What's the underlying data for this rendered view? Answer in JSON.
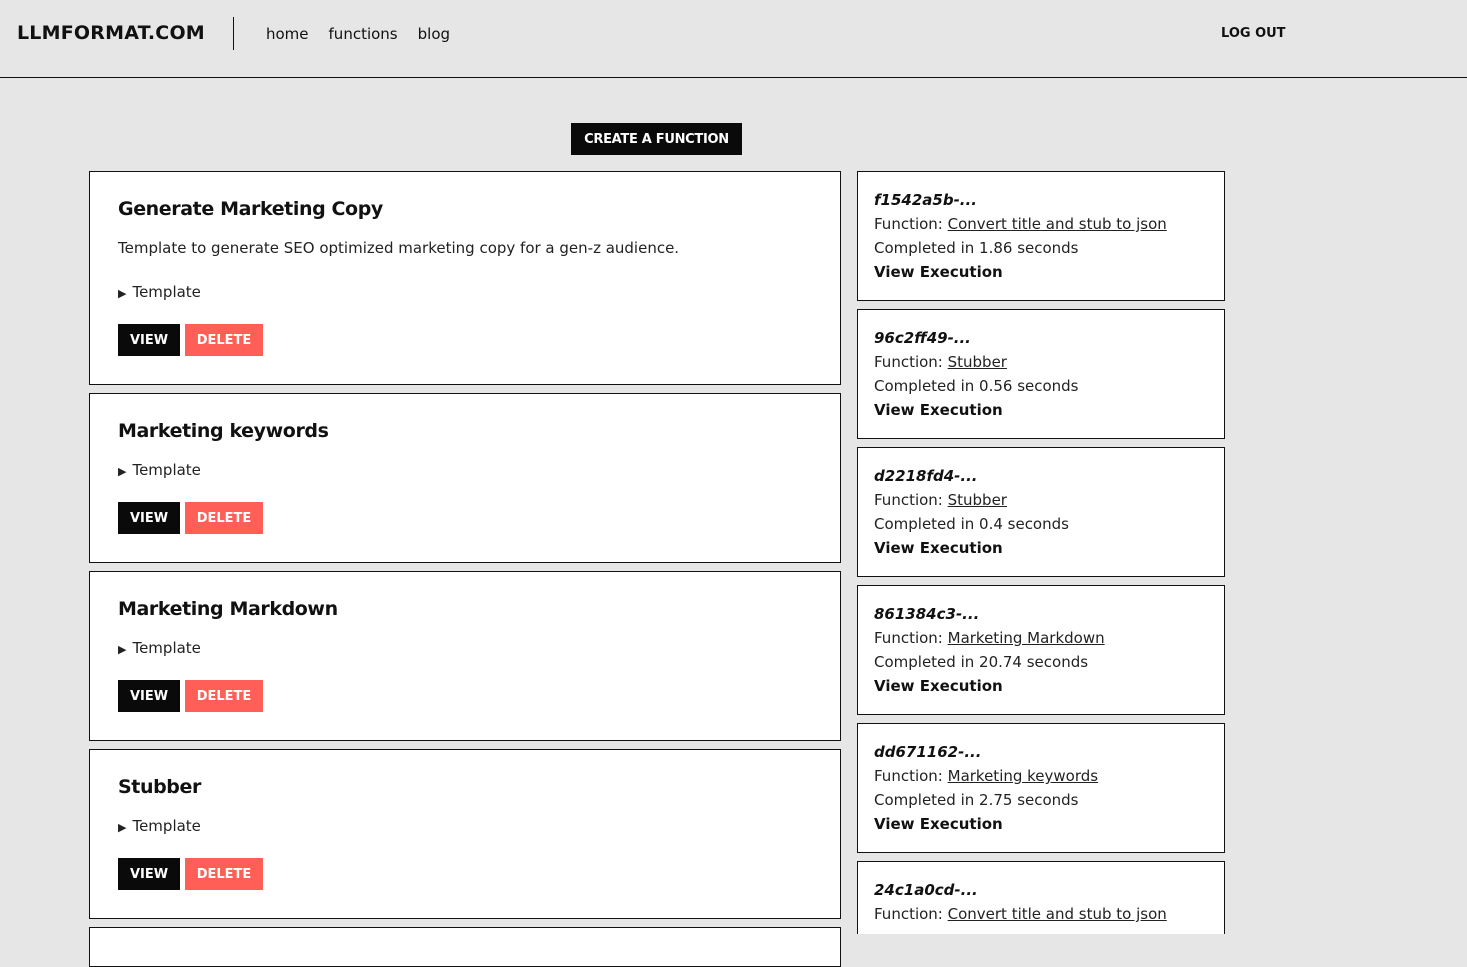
{
  "header": {
    "logo": "LLMFORMAT.COM",
    "nav": [
      "home",
      "functions",
      "blog"
    ],
    "logout": "LOG OUT"
  },
  "main": {
    "create_label": "CREATE A FUNCTION",
    "functions": [
      {
        "title": "Generate Marketing Copy",
        "description": "Template to generate SEO optimized marketing copy for a gen-z audience.",
        "template_label": "Template",
        "view": "VIEW",
        "delete": "DELETE"
      },
      {
        "title": "Marketing keywords",
        "template_label": "Template",
        "view": "VIEW",
        "delete": "DELETE"
      },
      {
        "title": "Marketing Markdown",
        "template_label": "Template",
        "view": "VIEW",
        "delete": "DELETE"
      },
      {
        "title": "Stubber",
        "template_label": "Template",
        "view": "VIEW",
        "delete": "DELETE"
      }
    ],
    "executions": [
      {
        "id": "f1542a5b-...",
        "fn_prefix": "Function: ",
        "fn_name": "Convert title and stub to json",
        "completed": "Completed in 1.86 seconds",
        "view": "View Execution"
      },
      {
        "id": "96c2ff49-...",
        "fn_prefix": "Function: ",
        "fn_name": "Stubber",
        "completed": "Completed in 0.56 seconds",
        "view": "View Execution"
      },
      {
        "id": "d2218fd4-...",
        "fn_prefix": "Function: ",
        "fn_name": "Stubber",
        "completed": "Completed in 0.4 seconds",
        "view": "View Execution"
      },
      {
        "id": "861384c3-...",
        "fn_prefix": "Function: ",
        "fn_name": "Marketing Markdown",
        "completed": "Completed in 20.74 seconds",
        "view": "View Execution"
      },
      {
        "id": "dd671162-...",
        "fn_prefix": "Function: ",
        "fn_name": "Marketing keywords",
        "completed": "Completed in 2.75 seconds",
        "view": "View Execution"
      },
      {
        "id": "24c1a0cd-...",
        "fn_prefix": "Function: ",
        "fn_name": "Convert title and stub to json"
      }
    ]
  },
  "colors": {
    "background": "#e6e6e6",
    "primary_button": "#0a0a0a",
    "delete_button": "#ff5f56",
    "card": "#ffffff"
  }
}
